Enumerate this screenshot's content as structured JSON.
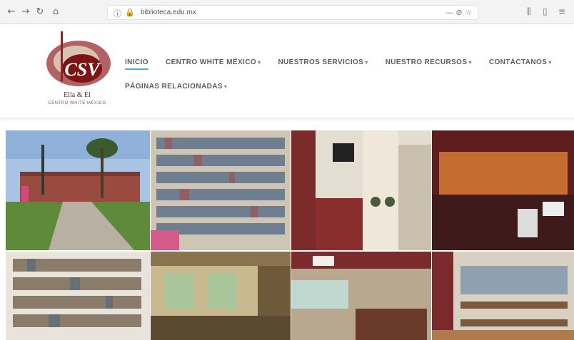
{
  "browser": {
    "url": "biblioteca.edu.mx",
    "zoom": "— ⊘ ☆"
  },
  "site": {
    "logo_main": "CSV",
    "logo_text": "Ella & Él",
    "logo_sub": "CENTRO WHITE MÉXICO"
  },
  "menu": {
    "items": [
      {
        "label": "INICIO",
        "dropdown": false
      },
      {
        "label": "CENTRO WHITE MÉXICO",
        "dropdown": true
      },
      {
        "label": "NUESTROS SERVICIOS",
        "dropdown": true
      },
      {
        "label": "NUESTRO RECURSOS",
        "dropdown": true
      },
      {
        "label": "CONTÁCTANOS",
        "dropdown": true
      },
      {
        "label": "PÁGINAS RELACIONADAS",
        "dropdown": true
      }
    ]
  },
  "colors": {
    "accent": "#2fa4c6",
    "brand_red": "#9b1c1c"
  }
}
